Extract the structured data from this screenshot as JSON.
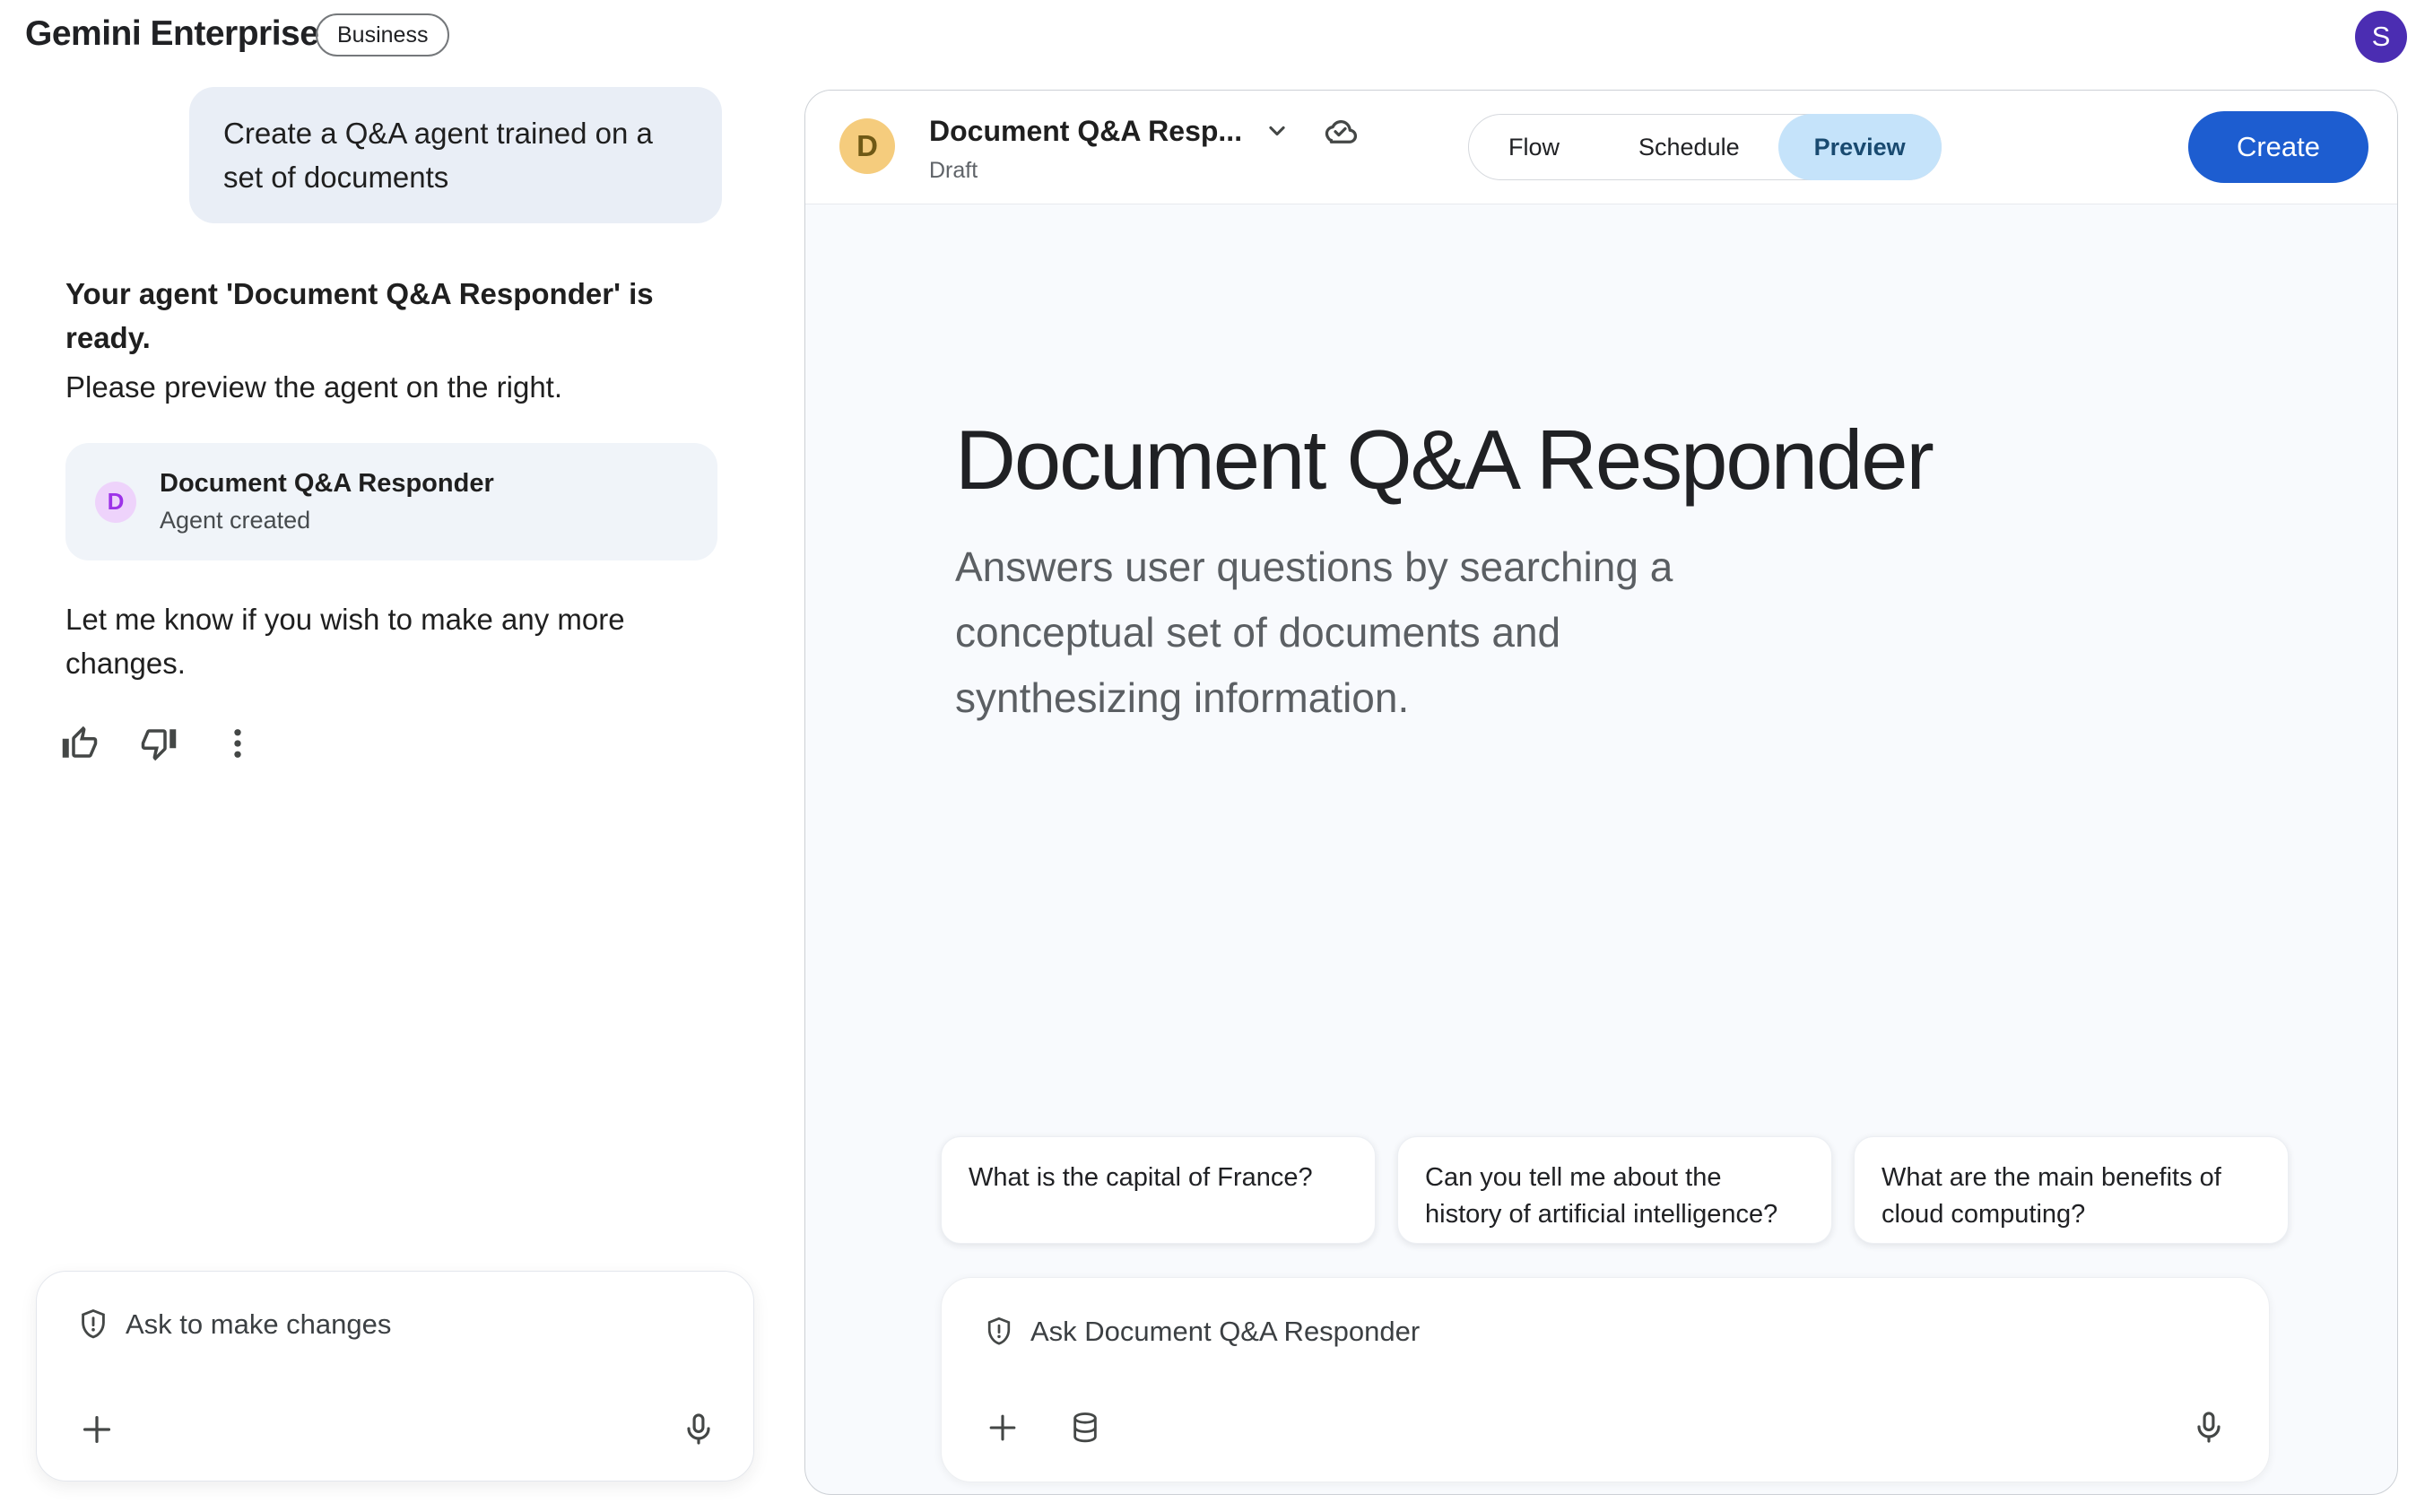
{
  "colors": {
    "accent_blue": "#1d5dd0",
    "preview_pill_bg": "#c5e3fa",
    "preview_pill_text": "#194a70",
    "user_avatar_purple": "#4b2db2",
    "agent_avatar_lavender_bg": "#eed3fb",
    "agent_avatar_lavender_text": "#9d32e8",
    "agent_avatar_amber_bg": "#f5cc7d",
    "agent_avatar_amber_text": "#6f5915",
    "user_bubble_bg": "#e9eef6",
    "agent_card_bg": "#f0f4f9",
    "panel_bg": "#f8fafd"
  },
  "header": {
    "brand": "Gemini Enterprise",
    "badge": "Business",
    "avatar_initial": "S"
  },
  "chat": {
    "user_message_lines": [
      "Create a Q&A agent trained on a",
      "set of documents"
    ],
    "assistant": {
      "bold_lines": [
        "Your agent 'Document Q&A Responder' is",
        "ready."
      ],
      "normal_line": "Please preview the agent on the right.",
      "agent_card": {
        "initial": "D",
        "title": "Document Q&A Responder",
        "subtitle": "Agent created"
      },
      "closing_lines": [
        "Let me know if you wish to make any more",
        "changes."
      ]
    },
    "feedback_icons": [
      "thumb-up",
      "thumb-down",
      "more-options"
    ],
    "input": {
      "placeholder": "Ask to make changes"
    }
  },
  "panel": {
    "header": {
      "agent_initial": "D",
      "title": "Document Q&A Resp...",
      "status": "Draft",
      "tabs": [
        {
          "label": "Flow",
          "active": false
        },
        {
          "label": "Schedule",
          "active": false
        },
        {
          "label": "Preview",
          "active": true
        }
      ],
      "create_label": "Create"
    },
    "preview": {
      "title": "Document Q&A Responder",
      "description_lines": [
        "Answers user questions by searching a",
        "conceptual set of documents and",
        "synthesizing information."
      ],
      "suggestions": [
        {
          "lines": [
            "What is the capital of France?"
          ]
        },
        {
          "lines": [
            "Can you tell me about the",
            "history of artificial intelligence?"
          ]
        },
        {
          "lines": [
            "What are the main benefits of",
            "cloud computing?"
          ]
        }
      ],
      "input": {
        "placeholder": "Ask Document Q&A Responder"
      }
    }
  }
}
